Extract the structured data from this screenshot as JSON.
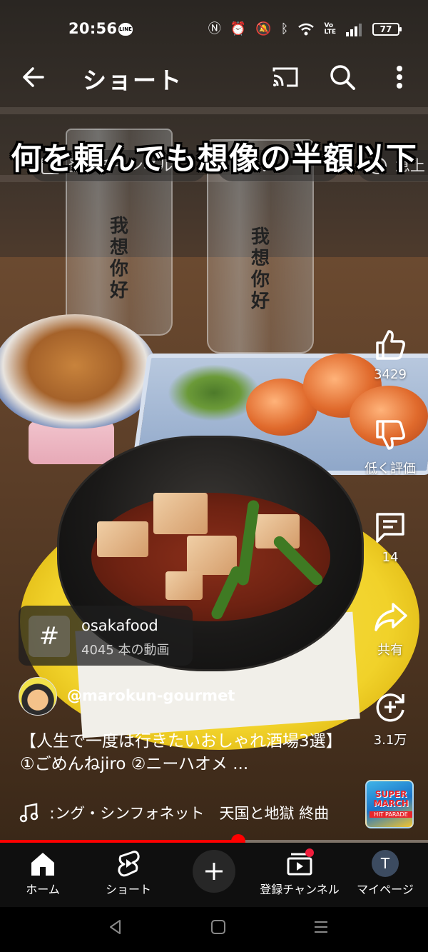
{
  "status_bar": {
    "time": "20:56",
    "battery": "77",
    "icons": [
      "line-icon",
      "nfc-icon",
      "alarm-icon",
      "mute-icon",
      "bluetooth-icon",
      "wifi-icon",
      "volte-icon",
      "signal-icon",
      "battery-icon"
    ]
  },
  "app_bar": {
    "title": "ショート"
  },
  "overlay": {
    "caption": "何を頼んでも想像の半額以下",
    "chips": [
      {
        "label": "登録チャンネル"
      },
      {
        "label": "ライブ"
      },
      {
        "label": "急上"
      }
    ]
  },
  "actions": {
    "like": "3429",
    "dislike": "低く評価",
    "comments": "14",
    "share": "共有",
    "remix": "3.1万"
  },
  "hashtag": {
    "symbol": "#",
    "name": "osakafood",
    "count": "4045 本の動画"
  },
  "channel": {
    "handle": "@marokun-gourmet"
  },
  "video": {
    "description": "【人生で一度は行きたいおしゃれ酒場3選】 ①ごめんねjiro ②ニーハオメ ...",
    "progress": 0.557
  },
  "sound": {
    "text": "ːング・シンフォネット　天国と地獄 終曲",
    "thumb_title": "SUPER MARCH",
    "thumb_sub": "HIT PARADE"
  },
  "bottom_nav": {
    "home": "ホーム",
    "shorts": "ショート",
    "subscriptions": "登録チャンネル",
    "you": "マイページ",
    "avatar_letter": "T"
  },
  "scene": {
    "glass_text": "我想你好"
  }
}
